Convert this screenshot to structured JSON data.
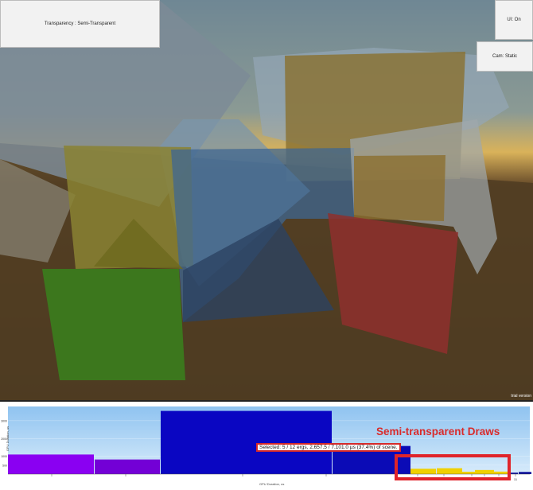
{
  "viewport": {
    "buttons": {
      "transparency_label": "Transparency : Semi-Transparent",
      "ui_label": "UI: On",
      "cam_label": "Cam: Static"
    },
    "watermark": "trial version"
  },
  "profiler": {
    "selection_text": "Selected: 5 / 12 ergs, 2,657.5 / 7,101.0 µs (37.4%) of scene.",
    "annotation_text": "Semi-transparent Draws",
    "x_axis_label": "GPU Duration, us",
    "y_axis_label": "GPU Duration, us",
    "y_ticks": [
      "3000",
      "2000",
      "1000",
      "500"
    ],
    "x_ticks": [
      "4",
      "5",
      "6",
      "7",
      "8",
      "11"
    ],
    "colors": {
      "bg_top": "#8fc3f0",
      "bg_bottom": "#d7ebfb",
      "purple": "#8a00f2",
      "violet": "#7300d6",
      "blue_big": "#0a06c2",
      "blue": "#0b0bb6",
      "yellow": "#f0d000",
      "navy": "#0a0c9a",
      "annotation_red": "#e0242a"
    },
    "bars": [
      {
        "color_key": "purple",
        "value": 1100
      },
      {
        "color_key": "violet",
        "value": 820
      },
      {
        "color_key": "blue_big",
        "value": 3550
      },
      {
        "color_key": "blue",
        "value": 1300
      },
      {
        "color_key": "blue",
        "value": 1580
      },
      {
        "color_key": "yellow",
        "value": 300
      },
      {
        "color_key": "yellow",
        "value": 330
      },
      {
        "color_key": "yellow",
        "value": 130
      },
      {
        "color_key": "yellow",
        "value": 230
      },
      {
        "color_key": "yellow",
        "value": 140
      },
      {
        "color_key": "navy",
        "value": 80
      },
      {
        "color_key": "navy",
        "value": 120
      }
    ]
  }
}
